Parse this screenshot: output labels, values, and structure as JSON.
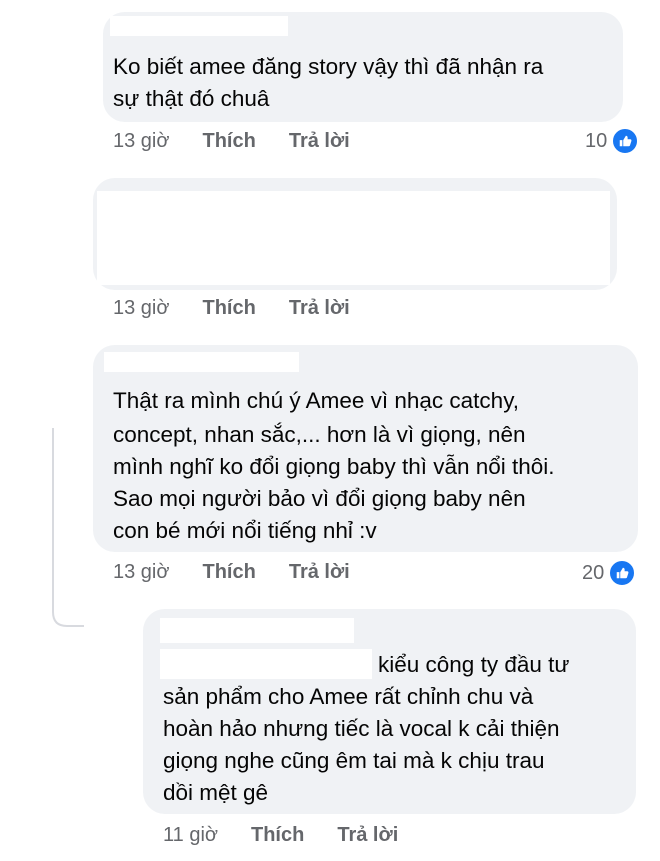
{
  "comments": [
    {
      "lines": [
        "Ko biết amee đăng story vậy thì đã nhận ra",
        "sự thật đó chuâ"
      ],
      "time": "13 giờ",
      "like_label": "Thích",
      "reply_label": "Trả lời",
      "reactions": "10"
    },
    {
      "lines": [],
      "time": "13 giờ",
      "like_label": "Thích",
      "reply_label": "Trả lời",
      "reactions": ""
    },
    {
      "lines": [
        "Thật ra mình chú ý Amee vì nhạc catchy,",
        "concept, nhan sắc,... hơn là vì giọng, nên",
        "mình nghĩ ko đổi giọng baby thì vẫn nổi thôi.",
        "Sao mọi người bảo vì đổi giọng baby nên",
        "con bé mới nổi tiếng nhỉ :v"
      ],
      "time": "13 giờ",
      "like_label": "Thích",
      "reply_label": "Trả lời",
      "reactions": "20"
    },
    {
      "lines": [
        "kiểu công ty đầu tư",
        "sản phẩm cho Amee rất chỉnh chu và",
        "hoàn hảo nhưng tiếc là vocal k cải thiện",
        "giọng nghe cũng êm tai mà k chịu trau",
        "dồi mệt gê"
      ],
      "time": "11 giờ",
      "like_label": "Thích",
      "reply_label": "Trả lời",
      "reactions": ""
    }
  ],
  "colors": {
    "bubble": "#f0f2f5",
    "meta": "#65676b",
    "like_badge": "#1877f2",
    "thread_line": "#d8dadf"
  },
  "icons": {
    "reaction": "like-icon"
  }
}
